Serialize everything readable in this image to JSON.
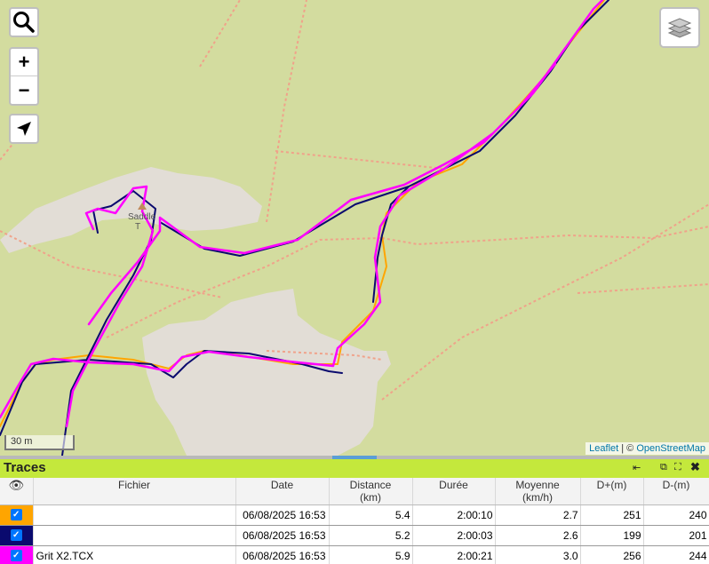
{
  "map": {
    "peak_label": "Saddle",
    "peak_label2": "T",
    "scale_label": "30 m",
    "attribution": {
      "leaflet": "Leaflet",
      "separator": " | © ",
      "osm": "OpenStreetMap"
    },
    "controls": {
      "zoom_in": "+",
      "zoom_out": "−"
    },
    "colors": {
      "land": "#d3dc9f",
      "rock": "#e2ddd6",
      "path": "#f0a28a",
      "track_orange": "#ffa500",
      "track_navy": "#0a0a6e",
      "track_magenta": "#ff00ff"
    }
  },
  "panel": {
    "title": "Traces",
    "icons": [
      "dock-icon",
      "popout-icon",
      "expand-icon",
      "close-icon"
    ],
    "columns": [
      "",
      "Fichier",
      "Date",
      "Distance",
      "(km)",
      "Durée",
      "Moyenne",
      "(km/h)",
      "D+(m)",
      "D-(m)"
    ],
    "rows": [
      {
        "color": "#ffa500",
        "file": "",
        "date": "06/08/2025 16:53",
        "distance": "5.4",
        "duree": "2:00:10",
        "moyenne": "2.7",
        "dplus": "251",
        "dminus": "240"
      },
      {
        "color": "#0a0a6e",
        "file": "",
        "date": "06/08/2025 16:53",
        "distance": "5.2",
        "duree": "2:00:03",
        "moyenne": "2.6",
        "dplus": "199",
        "dminus": "201"
      },
      {
        "color": "#ff00ff",
        "file": "Grit X2.TCX",
        "date": "06/08/2025 16:53",
        "distance": "5.9",
        "duree": "2:00:21",
        "moyenne": "3.0",
        "dplus": "256",
        "dminus": "244"
      }
    ]
  }
}
